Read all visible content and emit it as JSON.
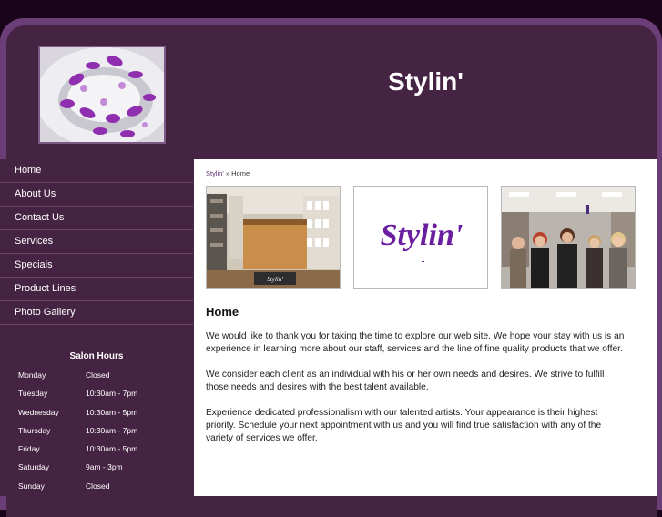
{
  "header": {
    "title": "Stylin'"
  },
  "nav": {
    "items": [
      {
        "label": "Home"
      },
      {
        "label": "About Us"
      },
      {
        "label": "Contact Us"
      },
      {
        "label": "Services"
      },
      {
        "label": "Specials"
      },
      {
        "label": "Product Lines"
      },
      {
        "label": "Photo Gallery"
      }
    ]
  },
  "hours": {
    "title": "Salon Hours",
    "rows": [
      {
        "day": "Monday",
        "time": "Closed"
      },
      {
        "day": "Tuesday",
        "time": "10:30am - 7pm"
      },
      {
        "day": "Wednesday",
        "time": "10:30am - 5pm"
      },
      {
        "day": "Thursday",
        "time": "10:30am - 7pm"
      },
      {
        "day": "Friday",
        "time": "10:30am - 5pm"
      },
      {
        "day": "Saturday",
        "time": "9am - 3pm"
      },
      {
        "day": "Sunday",
        "time": "Closed"
      }
    ]
  },
  "breadcrumb": {
    "root": "Stylin'",
    "separator": "»",
    "current": "Home"
  },
  "gallery": {
    "logo_text": "Stylin'",
    "sign_text": "Stylin'"
  },
  "main": {
    "heading": "Home",
    "paragraphs": [
      "We would like to thank you for taking the time to explore our web site. We hope your stay with us is an experience in learning more about our staff, services and the line of fine quality products that we offer.",
      "We consider each client as an individual with his or her own needs and desires. We strive to fulfill those needs and desires with the best talent available.",
      "Experience dedicated professionalism with our talented artists. Your appearance is their highest priority. Schedule your next appointment with us and you will find true satisfaction with any of the variety of services we offer."
    ]
  },
  "colors": {
    "accent": "#452342",
    "frame": "#6c3e78",
    "background": "#1a0419"
  }
}
